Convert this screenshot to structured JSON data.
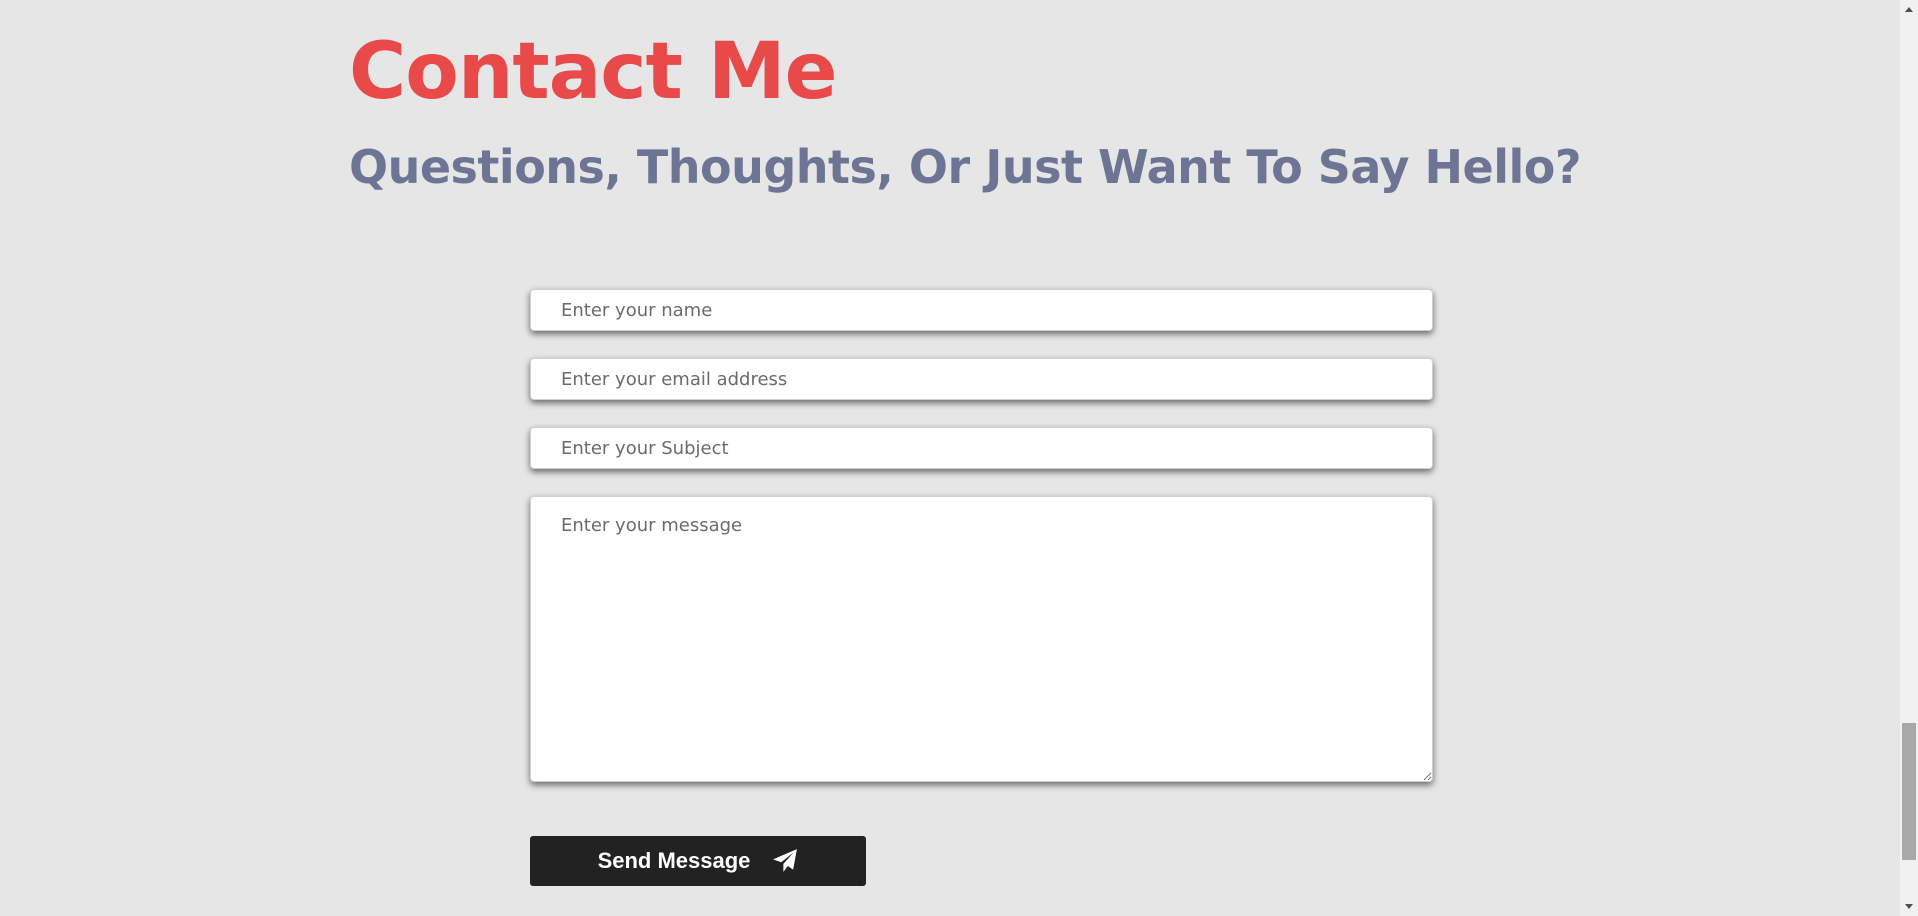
{
  "header": {
    "title": "Contact Me",
    "subtitle": "Questions, Thoughts, Or Just Want To Say Hello?"
  },
  "form": {
    "name_placeholder": "Enter your name",
    "email_placeholder": "Enter your email address",
    "subject_placeholder": "Enter your Subject",
    "message_placeholder": "Enter your message",
    "submit_label": "Send Message",
    "submit_icon": "paper-plane-icon"
  },
  "colors": {
    "background": "#e6e6e6",
    "title": "#e84a4a",
    "subtitle": "#6e7493",
    "button": "#222222"
  }
}
